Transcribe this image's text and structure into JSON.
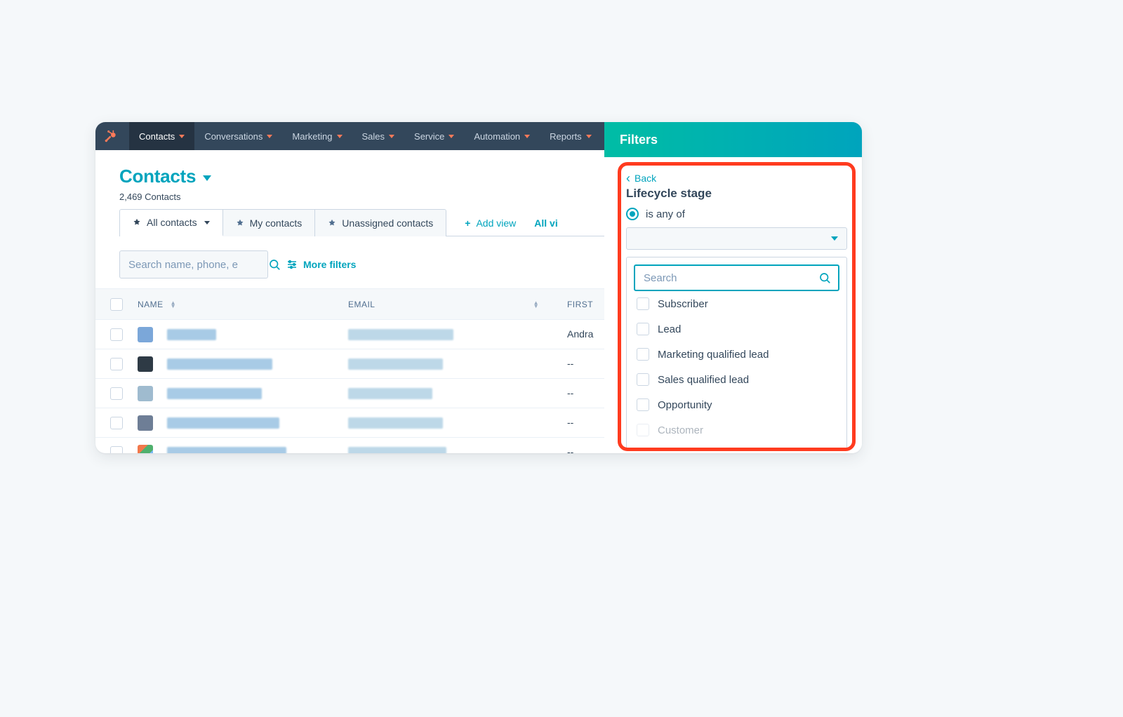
{
  "nav": {
    "items": [
      {
        "label": "Contacts",
        "active": true
      },
      {
        "label": "Conversations"
      },
      {
        "label": "Marketing"
      },
      {
        "label": "Sales"
      },
      {
        "label": "Service"
      },
      {
        "label": "Automation"
      },
      {
        "label": "Reports"
      }
    ]
  },
  "header": {
    "title": "Contacts",
    "count": "2,469 Contacts"
  },
  "tabs": {
    "items": [
      {
        "label": "All contacts",
        "active": true,
        "has_caret": true
      },
      {
        "label": "My contacts"
      },
      {
        "label": "Unassigned contacts"
      }
    ],
    "add_view": "Add view",
    "all_views": "All vi"
  },
  "toolbar": {
    "search_placeholder": "Search name, phone, e",
    "more_filters": "More filters"
  },
  "table": {
    "columns": {
      "name": "NAME",
      "email": "EMAIL",
      "first": "FIRST"
    },
    "rows": [
      {
        "avatar_color": "#7BA7D9",
        "first": "Andra"
      },
      {
        "avatar_color": "#2E3A45",
        "first": "--"
      },
      {
        "avatar_color": "#9FBBCF",
        "first": "--"
      },
      {
        "avatar_color": "#6E7E96",
        "first": "--"
      },
      {
        "avatar_color": "gradient",
        "first": "--"
      }
    ]
  },
  "filters": {
    "title": "Filters",
    "back": "Back",
    "property": "Lifecycle stage",
    "condition": "is any of",
    "search_placeholder": "Search",
    "options": [
      "Subscriber",
      "Lead",
      "Marketing qualified lead",
      "Sales qualified lead",
      "Opportunity",
      "Customer"
    ]
  }
}
